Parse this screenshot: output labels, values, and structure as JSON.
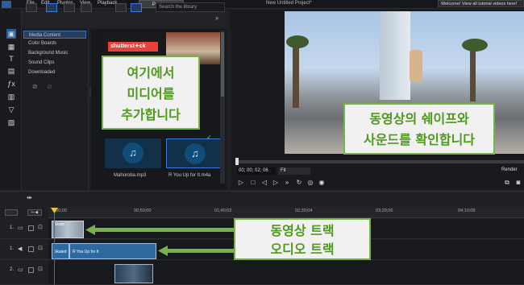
{
  "menu": [
    "File",
    "Edit",
    "Plugins",
    "View",
    "Playback"
  ],
  "produce_label": "Produce",
  "project_title": "New Untitled Project*",
  "welcome_banner": "Welcome! View all tutorial videos here!",
  "library": {
    "search_placeholder": "Search the library",
    "categories": [
      "Media Content",
      "Color Boards",
      "Background Music",
      "Sound Clips",
      "Downloaded"
    ],
    "selected_category": "Media Content",
    "items": [
      {
        "label": "",
        "kind": "image",
        "text": "shutterst✦ck"
      },
      {
        "label": "",
        "kind": "image"
      },
      {
        "label": "Mahoroba.mp3",
        "kind": "audio"
      },
      {
        "label": "R You Up for It.m4a",
        "kind": "audio"
      }
    ]
  },
  "preview": {
    "timecode": "00; 00; 02; 06",
    "fit_label": "Fit",
    "render_label": "Render"
  },
  "timeline": {
    "ruler": [
      "00;00",
      "00;50;00",
      "01;40;02",
      "02;30;04",
      "03;20;06",
      "04;10;08"
    ],
    "tracks": [
      {
        "num": "1.",
        "type": "video"
      },
      {
        "num": "1.",
        "type": "audio"
      },
      {
        "num": "2.",
        "type": "video"
      }
    ],
    "clips": {
      "video1_label": "Skate",
      "audio1_label": "Skated",
      "audio1_label2": "R You Up for It"
    }
  },
  "overlays": {
    "add_media_line1": "여기에서",
    "add_media_line2": "미디어를",
    "add_media_line3": "추가합니다",
    "preview_line1": "동영상의 쉐이프와",
    "preview_line2": "사운드를 확인합니다",
    "track_line1": "동영상 트랙",
    "track_line2": "오디오 트랙"
  },
  "colors": {
    "accent": "#3a7bd5",
    "callout_border": "#78b34a",
    "callout_text": "#4e9a1c",
    "audio_clip": "#2e6aa0",
    "playhead": "#e2322d"
  }
}
